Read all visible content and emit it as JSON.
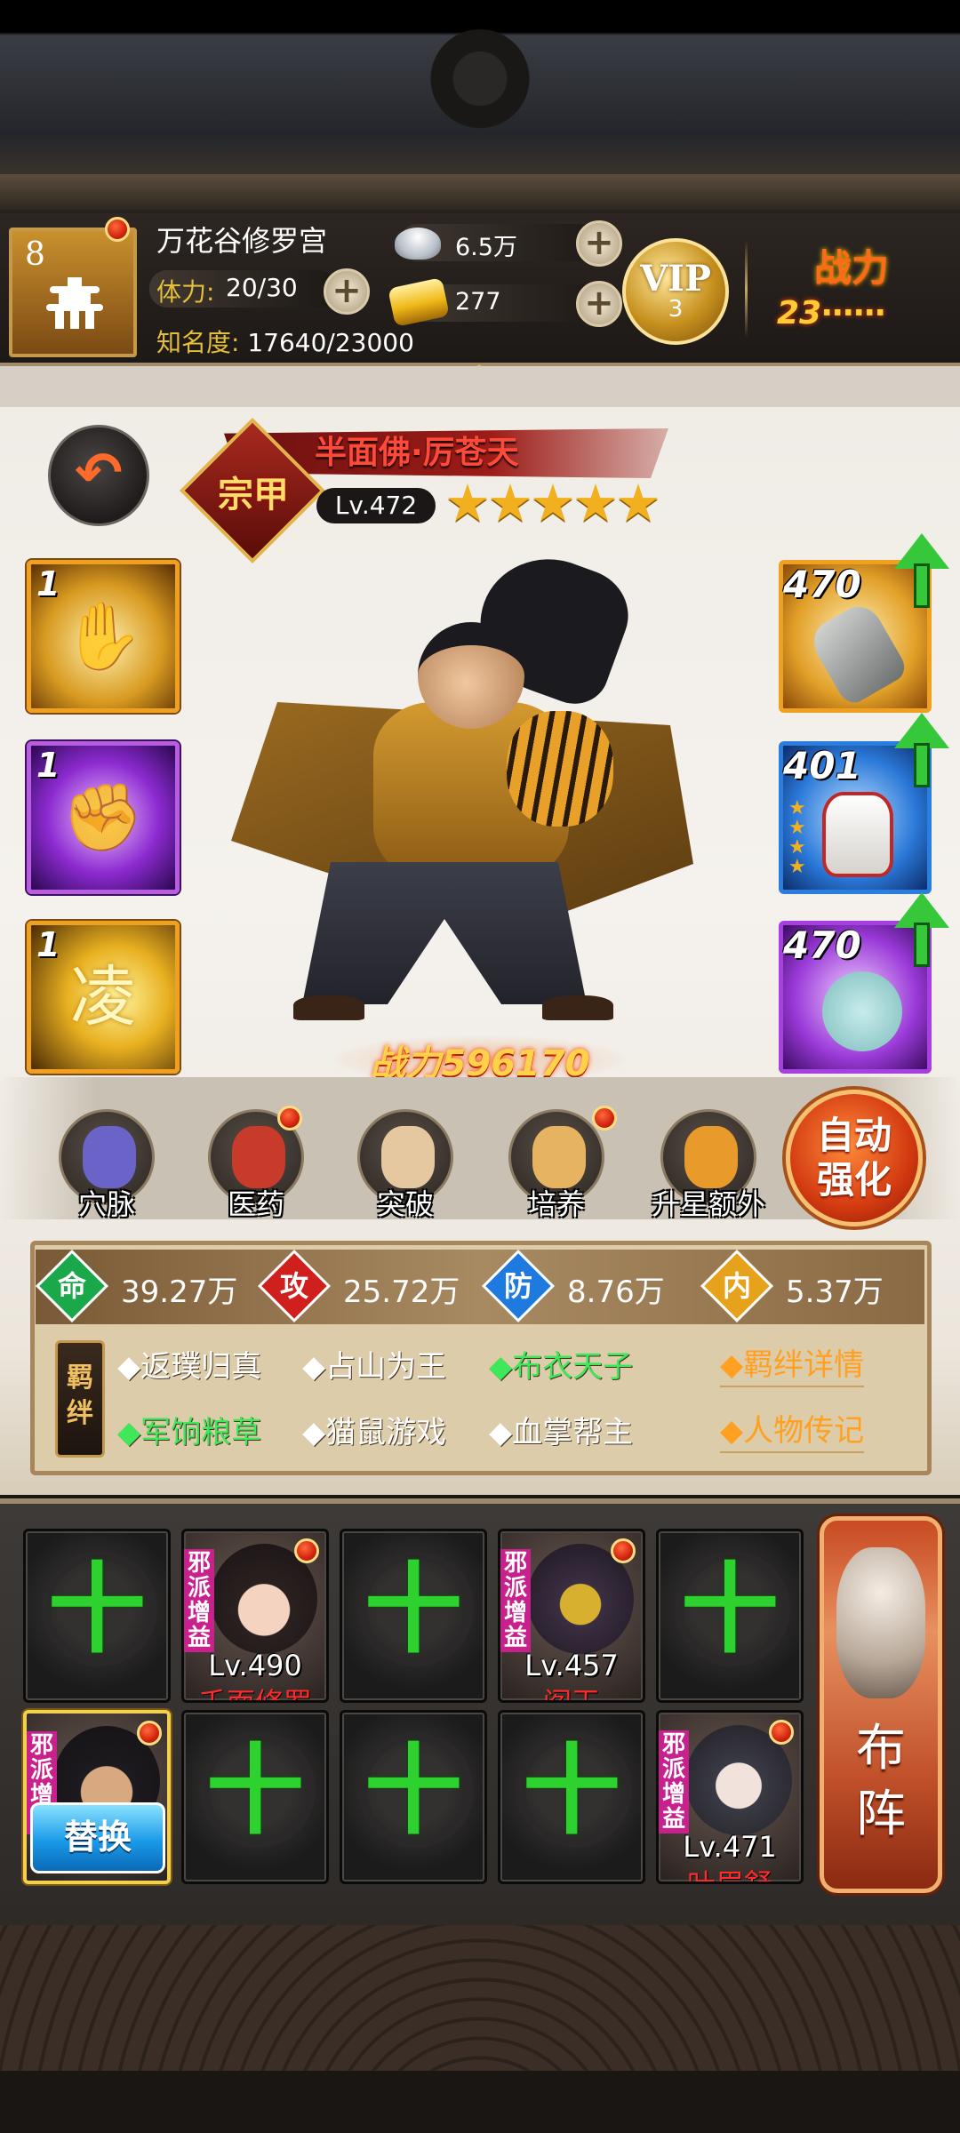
{
  "player": {
    "level": "8",
    "name": "万花谷修罗宫",
    "stamina_label": "体力:",
    "stamina_value": "20/30",
    "fame_label": "知名度:",
    "fame_value": "17640/23000",
    "silver": "6.5万",
    "gold": "277",
    "vip_label": "VIP",
    "vip_level": "3",
    "power_label": "战力",
    "power_value": "23⋯⋯"
  },
  "hero": {
    "badge": "宗甲",
    "name": "半面佛·厉苍天",
    "level": "Lv.472",
    "stars": 5,
    "stars_text": "★★★★★",
    "combat_power_text": "战力596170"
  },
  "skills": [
    {
      "level": "1",
      "icon": "palm-icon",
      "glyph": "✋"
    },
    {
      "level": "1",
      "icon": "fist-icon",
      "glyph": "✊"
    },
    {
      "level": "1",
      "icon": "boot-icon",
      "glyph": "凌"
    }
  ],
  "equipment": [
    {
      "level": "470",
      "icon": "gauntlet-icon"
    },
    {
      "level": "401",
      "icon": "robe-icon",
      "stars": "★★★★"
    },
    {
      "level": "470",
      "icon": "jade-pendant-icon"
    }
  ],
  "actions": [
    {
      "label": "穴脉",
      "icon": "meridian-icon"
    },
    {
      "label": "医药",
      "icon": "medicine-icon"
    },
    {
      "label": "突破",
      "icon": "breakthrough-icon"
    },
    {
      "label": "培养",
      "icon": "cultivate-icon"
    },
    {
      "label": "升星额外",
      "icon": "star-up-icon"
    }
  ],
  "auto_enhance": {
    "line1": "自动",
    "line2": "强化"
  },
  "stats": [
    {
      "key": "命",
      "value": "39.27万",
      "color": "#1aa84a"
    },
    {
      "key": "攻",
      "value": "25.72万",
      "color": "#d0201e"
    },
    {
      "key": "防",
      "value": "8.76万",
      "color": "#1f7ae0"
    },
    {
      "key": "内",
      "value": "5.37万",
      "color": "#e6a21a"
    }
  ],
  "bonds_tag": "羁绊",
  "bonds": [
    {
      "text": "◆返璞归真",
      "active": false
    },
    {
      "text": "◆占山为王",
      "active": false
    },
    {
      "text": "◆布衣天子",
      "active": true
    },
    {
      "text": "◆军饷粮草",
      "active": true
    },
    {
      "text": "◆猫鼠游戏",
      "active": false
    },
    {
      "text": "◆血掌帮主",
      "active": false
    }
  ],
  "links": {
    "bond_details": "◆羁绊详情",
    "biography": "◆人物传记"
  },
  "formation": {
    "plus": "十",
    "evil_tag": "邪派增益",
    "heroes": [
      {
        "level": "Lv.490",
        "name": "千面修罗"
      },
      {
        "level": "Lv.457",
        "name": "阎王"
      },
      {
        "level": "Lv.471",
        "name": "叶眉舒"
      }
    ],
    "replace_label": "替换",
    "deploy_line1": "布",
    "deploy_line2": "阵"
  },
  "colors": {
    "accent_gold": "#e4c03a",
    "power_orange": "#ff6a1a",
    "plus_green": "#2ed22e",
    "hero_red": "#ff2a2a"
  }
}
